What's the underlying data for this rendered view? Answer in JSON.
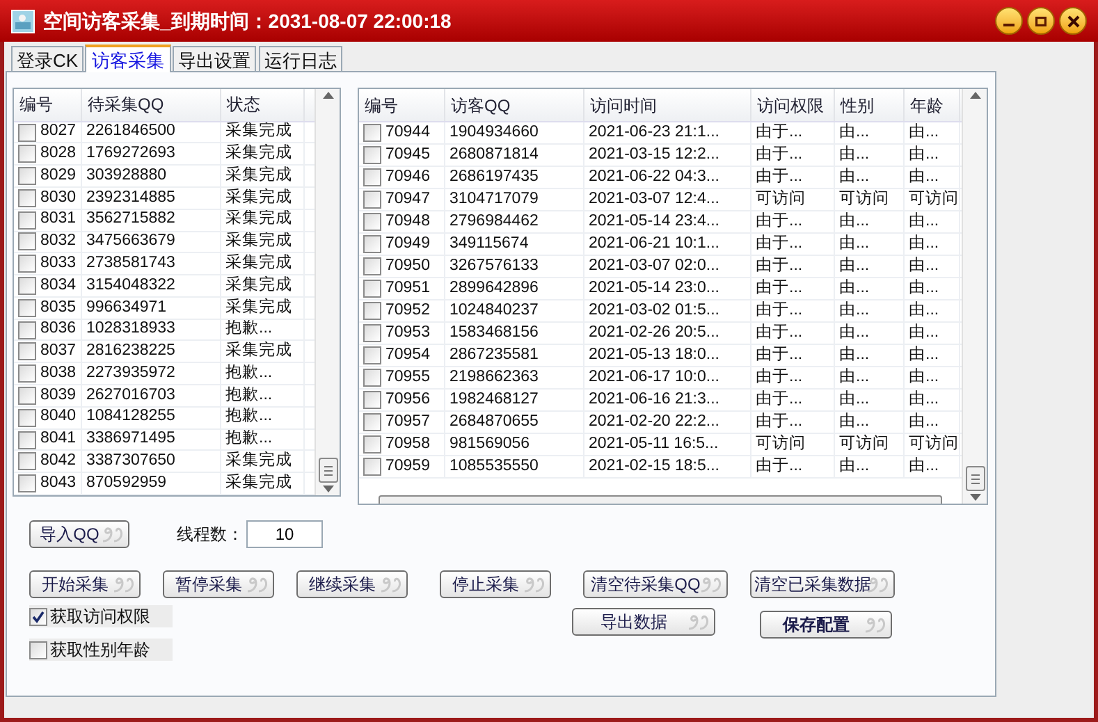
{
  "window": {
    "title": "空间访客采集_到期时间：2031-08-07 22:00:18"
  },
  "tabs": [
    {
      "label": "登录CK",
      "selected": false
    },
    {
      "label": "访客采集",
      "selected": true
    },
    {
      "label": "导出设置",
      "selected": false
    },
    {
      "label": "运行日志",
      "selected": false
    }
  ],
  "queue_table": {
    "columns": [
      "编号",
      "待采集QQ",
      "状态"
    ],
    "rows": [
      {
        "checked": false,
        "cells": [
          "8027",
          "2261846500",
          "采集完成"
        ]
      },
      {
        "checked": false,
        "cells": [
          "8028",
          "1769272693",
          "采集完成"
        ]
      },
      {
        "checked": false,
        "cells": [
          "8029",
          "303928880",
          "采集完成"
        ]
      },
      {
        "checked": false,
        "cells": [
          "8030",
          "2392314885",
          "采集完成"
        ]
      },
      {
        "checked": false,
        "cells": [
          "8031",
          "3562715882",
          "采集完成"
        ]
      },
      {
        "checked": false,
        "cells": [
          "8032",
          "3475663679",
          "采集完成"
        ]
      },
      {
        "checked": false,
        "cells": [
          "8033",
          "2738581743",
          "采集完成"
        ]
      },
      {
        "checked": false,
        "cells": [
          "8034",
          "3154048322",
          "采集完成"
        ]
      },
      {
        "checked": false,
        "cells": [
          "8035",
          "996634971",
          "采集完成"
        ]
      },
      {
        "checked": false,
        "cells": [
          "8036",
          "1028318933",
          "抱歉..."
        ]
      },
      {
        "checked": false,
        "cells": [
          "8037",
          "2816238225",
          "采集完成"
        ]
      },
      {
        "checked": false,
        "cells": [
          "8038",
          "2273935972",
          "抱歉..."
        ]
      },
      {
        "checked": false,
        "cells": [
          "8039",
          "2627016703",
          "抱歉..."
        ]
      },
      {
        "checked": false,
        "cells": [
          "8040",
          "1084128255",
          "抱歉..."
        ]
      },
      {
        "checked": false,
        "cells": [
          "8041",
          "3386971495",
          "抱歉..."
        ]
      },
      {
        "checked": false,
        "cells": [
          "8042",
          "3387307650",
          "采集完成"
        ]
      },
      {
        "checked": false,
        "cells": [
          "8043",
          "870592959",
          "采集完成"
        ]
      }
    ]
  },
  "visitor_table": {
    "columns": [
      "编号",
      "访客QQ",
      "访问时间",
      "访问权限",
      "性别",
      "年龄"
    ],
    "rows": [
      {
        "checked": false,
        "cells": [
          "70944",
          "1904934660",
          "2021-06-23 21:1...",
          "由于...",
          "由...",
          "由..."
        ]
      },
      {
        "checked": false,
        "cells": [
          "70945",
          "2680871814",
          "2021-03-15 12:2...",
          "由于...",
          "由...",
          "由..."
        ]
      },
      {
        "checked": false,
        "cells": [
          "70946",
          "2686197435",
          "2021-06-22 04:3...",
          "由于...",
          "由...",
          "由..."
        ]
      },
      {
        "checked": false,
        "cells": [
          "70947",
          "3104717079",
          "2021-03-07 12:4...",
          "可访问",
          "可访问",
          "可访问"
        ]
      },
      {
        "checked": false,
        "cells": [
          "70948",
          "2796984462",
          "2021-05-14 23:4...",
          "由于...",
          "由...",
          "由..."
        ]
      },
      {
        "checked": false,
        "cells": [
          "70949",
          "349115674",
          "2021-06-21 10:1...",
          "由于...",
          "由...",
          "由..."
        ]
      },
      {
        "checked": false,
        "cells": [
          "70950",
          "3267576133",
          "2021-03-07 02:0...",
          "由于...",
          "由...",
          "由..."
        ]
      },
      {
        "checked": false,
        "cells": [
          "70951",
          "2899642896",
          "2021-05-14 23:0...",
          "由于...",
          "由...",
          "由..."
        ]
      },
      {
        "checked": false,
        "cells": [
          "70952",
          "1024840237",
          "2021-03-02 01:5...",
          "由于...",
          "由...",
          "由..."
        ]
      },
      {
        "checked": false,
        "cells": [
          "70953",
          "1583468156",
          "2021-02-26 20:5...",
          "由于...",
          "由...",
          "由..."
        ]
      },
      {
        "checked": false,
        "cells": [
          "70954",
          "2867235581",
          "2021-05-13 18:0...",
          "由于...",
          "由...",
          "由..."
        ]
      },
      {
        "checked": false,
        "cells": [
          "70955",
          "2198662363",
          "2021-06-17 10:0...",
          "由于...",
          "由...",
          "由..."
        ]
      },
      {
        "checked": false,
        "cells": [
          "70956",
          "1982468127",
          "2021-06-16 21:3...",
          "由于...",
          "由...",
          "由..."
        ]
      },
      {
        "checked": false,
        "cells": [
          "70957",
          "2684870655",
          "2021-02-20 22:2...",
          "由于...",
          "由...",
          "由..."
        ]
      },
      {
        "checked": false,
        "cells": [
          "70958",
          "981569056",
          "2021-05-11 16:5...",
          "可访问",
          "可访问",
          "可访问"
        ]
      },
      {
        "checked": false,
        "cells": [
          "70959",
          "1085535550",
          "2021-02-15 18:5...",
          "由于...",
          "由...",
          "由..."
        ]
      }
    ]
  },
  "import_button": "导入QQ",
  "threads": {
    "label": "线程数：",
    "value": "10"
  },
  "actions": [
    "开始采集",
    "暂停采集",
    "继续采集",
    "停止采集",
    "清空待采集QQ",
    "清空已采集数据"
  ],
  "options": [
    {
      "label": "获取访问权限",
      "checked": true
    },
    {
      "label": "获取性别年龄",
      "checked": false
    }
  ],
  "export_button": "导出数据",
  "save_button": "保存配置"
}
